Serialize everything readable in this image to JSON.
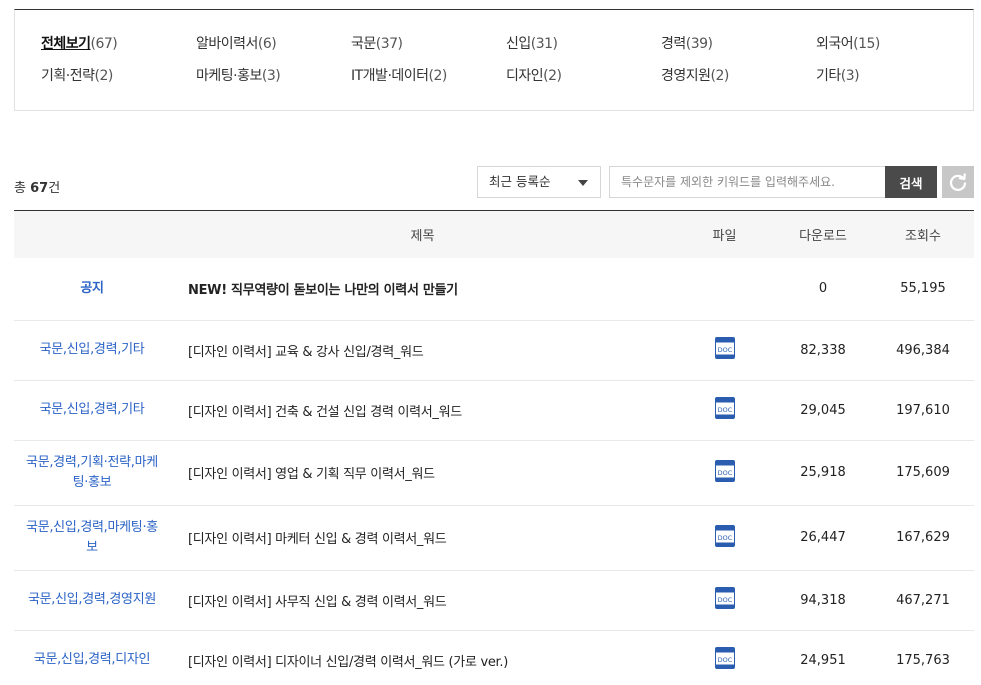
{
  "categories": [
    {
      "name": "전체보기",
      "count": "(67)",
      "active": true
    },
    {
      "name": "알바이력서",
      "count": "(6)"
    },
    {
      "name": "국문",
      "count": "(37)"
    },
    {
      "name": "신입",
      "count": "(31)"
    },
    {
      "name": "경력",
      "count": "(39)"
    },
    {
      "name": "외국어",
      "count": "(15)"
    },
    {
      "name": "기획·전략",
      "count": "(2)"
    },
    {
      "name": "마케팅·홍보",
      "count": "(3)"
    },
    {
      "name": "IT개발·데이터",
      "count": "(2)"
    },
    {
      "name": "디자인",
      "count": "(2)"
    },
    {
      "name": "경영지원",
      "count": "(2)"
    },
    {
      "name": "기타",
      "count": "(3)"
    }
  ],
  "total": {
    "prefix": "총 ",
    "count": "67",
    "suffix": "건"
  },
  "sort": {
    "selected": "최근 등록순"
  },
  "search": {
    "placeholder": "특수문자를 제외한 키워드를 입력해주세요.",
    "button_label": "검색"
  },
  "table": {
    "headers": {
      "category": "",
      "title": "제목",
      "file": "파일",
      "downloads": "다운로드",
      "views": "조회수"
    },
    "rows": [
      {
        "category": "공지",
        "title": "NEW! 직무역량이 돋보이는 나만의 이력서 만들기",
        "file": false,
        "downloads": "0",
        "views": "55,195",
        "notice": true
      },
      {
        "category": "국문,신입,경력,기타",
        "title": "[디자인 이력서] 교육 & 강사 신입/경력_워드",
        "file": true,
        "downloads": "82,338",
        "views": "496,384"
      },
      {
        "category": "국문,신입,경력,기타",
        "title": "[디자인 이력서] 건축 & 건설 신입 경력 이력서_워드",
        "file": true,
        "downloads": "29,045",
        "views": "197,610"
      },
      {
        "category": "국문,경력,기획·전략,마케팅·홍보",
        "title": "[디자인 이력서] 영업 & 기획 직무 이력서_워드",
        "file": true,
        "downloads": "25,918",
        "views": "175,609"
      },
      {
        "category": "국문,신입,경력,마케팅·홍보",
        "title": "[디자인 이력서] 마케터 신입 & 경력 이력서_워드",
        "file": true,
        "downloads": "26,447",
        "views": "167,629"
      },
      {
        "category": "국문,신입,경력,경영지원",
        "title": "[디자인 이력서] 사무직 신입 & 경력 이력서_워드",
        "file": true,
        "downloads": "94,318",
        "views": "467,271"
      },
      {
        "category": "국문,신입,경력,디자인",
        "title": "[디자인 이력서] 디자이너 신입/경력 이력서_워드 (가로 ver.)",
        "file": true,
        "downloads": "24,951",
        "views": "175,763"
      }
    ]
  },
  "icons": {
    "file": "doc-file-icon",
    "reset": "refresh-icon",
    "sort": "chevron-down-icon"
  },
  "colors": {
    "category_link": "#2b63c6",
    "search_button": "#4a4a4a",
    "reset_button": "#c7c7c7",
    "doc_icon": "#2a5db0"
  }
}
